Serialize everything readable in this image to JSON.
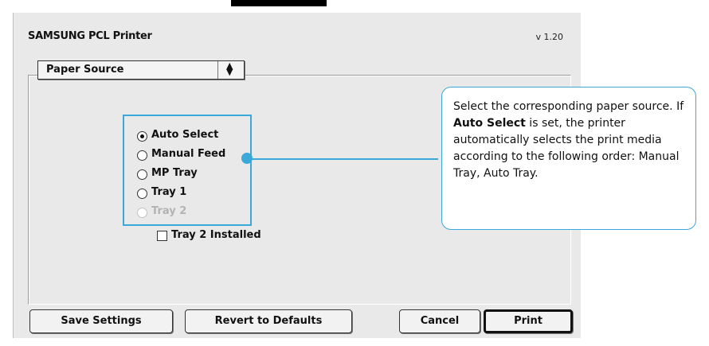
{
  "window": {
    "printer_name": "SAMSUNG PCL Printer",
    "version": "v 1.20"
  },
  "panel_menu": {
    "selected": "Paper Source",
    "arrows": "⬍"
  },
  "paper_source": {
    "options": [
      {
        "label": "Auto Select",
        "selected": true,
        "enabled": true
      },
      {
        "label": "Manual Feed",
        "selected": false,
        "enabled": true
      },
      {
        "label": "MP Tray",
        "selected": false,
        "enabled": true
      },
      {
        "label": "Tray 1",
        "selected": false,
        "enabled": true
      },
      {
        "label": "Tray 2",
        "selected": false,
        "enabled": false
      }
    ],
    "tray2_installed_label": "Tray 2 Installed",
    "tray2_installed_checked": false
  },
  "callout": {
    "text_before": "Select the corresponding paper source. If ",
    "bold": "Auto Select",
    "text_after": " is set, the printer automatically selects the print media according to the following order: Manual Tray, Auto Tray."
  },
  "buttons": {
    "save": "Save Settings",
    "revert": "Revert to Defaults",
    "cancel": "Cancel",
    "print": "Print"
  },
  "colors": {
    "accent": "#3aa8d8",
    "dialog_bg": "#e9e9e9"
  }
}
